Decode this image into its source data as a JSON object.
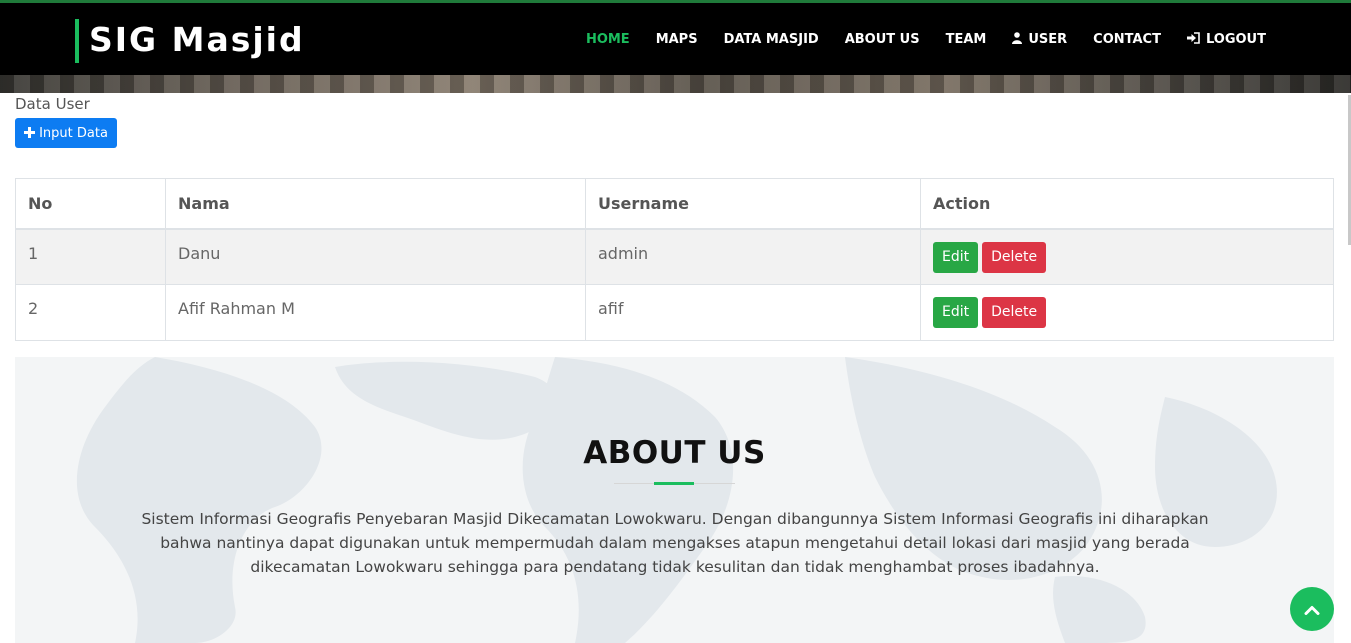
{
  "brand": "SIG Masjid",
  "nav": [
    {
      "label": "HOME",
      "icon": "",
      "active": true
    },
    {
      "label": "MAPS",
      "icon": ""
    },
    {
      "label": "DATA MASJID",
      "icon": ""
    },
    {
      "label": "ABOUT US",
      "icon": ""
    },
    {
      "label": "TEAM",
      "icon": ""
    },
    {
      "label": "USER",
      "icon": "user-icon"
    },
    {
      "label": "CONTACT",
      "icon": ""
    },
    {
      "label": "LOGOUT",
      "icon": "logout-icon"
    }
  ],
  "page_label": "Data User",
  "input_button": "Input Data",
  "table": {
    "headers": [
      "No",
      "Nama",
      "Username",
      "Action"
    ],
    "rows": [
      {
        "no": "1",
        "nama": "Danu",
        "username": "admin",
        "edit": "Edit",
        "delete": "Delete"
      },
      {
        "no": "2",
        "nama": "Afif Rahman M",
        "username": "afif",
        "edit": "Edit",
        "delete": "Delete"
      }
    ]
  },
  "about": {
    "title": "ABOUT US",
    "text": "Sistem Informasi Geografis Penyebaran Masjid Dikecamatan Lowokwaru. Dengan dibangunnya Sistem Informasi Geografis ini diharapkan bahwa nantinya dapat digunakan untuk mempermudah dalam mengakses atapun mengetahui detail lokasi dari masjid yang berada dikecamatan Lowokwaru sehingga para pendatang tidak kesulitan dan tidak menghambat proses ibadahnya."
  },
  "colors": {
    "accent": "#1bbd5e",
    "primary_button": "#0d7cf2",
    "edit_button": "#28a745",
    "delete_button": "#dc3545"
  }
}
